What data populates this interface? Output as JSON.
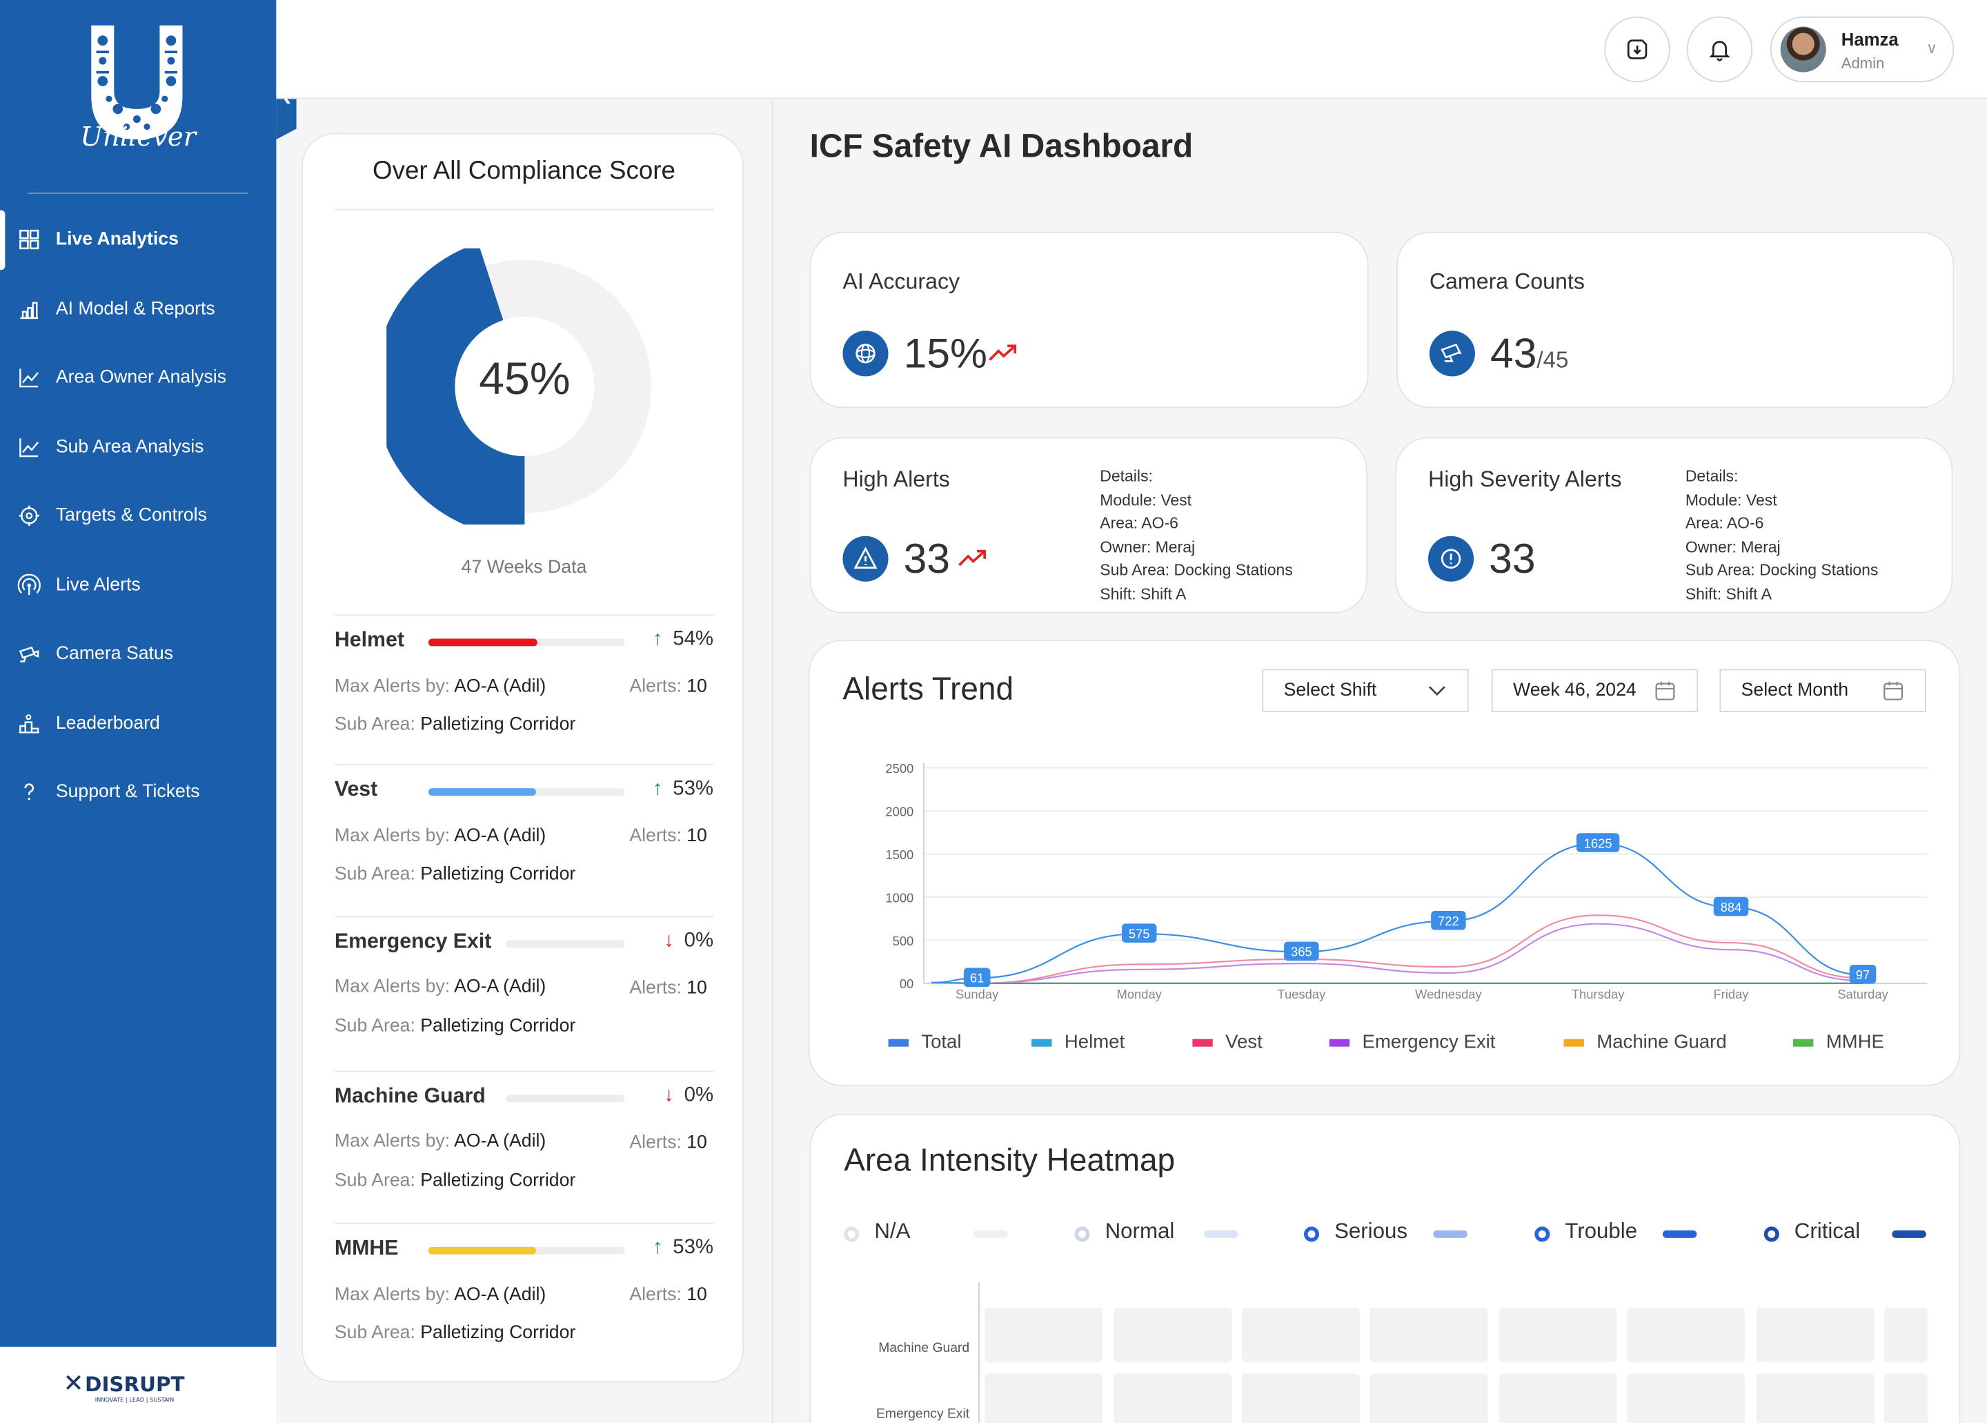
{
  "brand": {
    "name": "Unilever",
    "footer_logo": "THE DISRUPT LABS",
    "footer_tagline": "INNOVATE | LEAD | SUSTAIN"
  },
  "sidebar": {
    "items": [
      {
        "label": "Live Analytics",
        "icon": "grid-icon",
        "active": true
      },
      {
        "label": "AI Model & Reports",
        "icon": "bar-chart-icon"
      },
      {
        "label": "Area Owner Analysis",
        "icon": "line-chart-icon"
      },
      {
        "label": "Sub Area Analysis",
        "icon": "line-chart-icon"
      },
      {
        "label": "Targets & Controls",
        "icon": "target-icon"
      },
      {
        "label": "Live Alerts",
        "icon": "broadcast-icon"
      },
      {
        "label": "Camera Satus",
        "icon": "camera-icon"
      },
      {
        "label": "Leaderboard",
        "icon": "podium-icon"
      },
      {
        "label": "Support & Tickets",
        "icon": "question-icon"
      }
    ]
  },
  "user": {
    "name": "Hamza",
    "role": "Admin"
  },
  "compliance": {
    "title": "Over All Compliance Score",
    "score": "45%",
    "score_value": 45,
    "footnote": "47 Weeks Data",
    "max_alerts_label": "Max Alerts by:",
    "alerts_label": "Alerts:",
    "sub_area_label": "Sub Area:",
    "categories": [
      {
        "name": "Helmet",
        "pct": "54%",
        "fill": 54,
        "trend": "up",
        "color": "#e8141c",
        "owner": "AO-A (Adil)",
        "alerts": "10",
        "sub_area": "Palletizing Corridor"
      },
      {
        "name": "Vest",
        "pct": "53%",
        "fill": 53,
        "trend": "up",
        "color": "#58a6f0",
        "owner": "AO-A (Adil)",
        "alerts": "10",
        "sub_area": "Palletizing Corridor"
      },
      {
        "name": "Emergency Exit",
        "pct": "0%",
        "fill": 0,
        "trend": "down",
        "color": "#58a6f0",
        "owner": "AO-A (Adil)",
        "alerts": "10",
        "sub_area": "Palletizing Corridor"
      },
      {
        "name": "Machine Guard",
        "pct": "0%",
        "fill": 0,
        "trend": "down",
        "color": "#58a6f0",
        "owner": "AO-A (Adil)",
        "alerts": "10",
        "sub_area": "Palletizing Corridor"
      },
      {
        "name": "MMHE",
        "pct": "53%",
        "fill": 53,
        "trend": "up",
        "color": "#f2c92d",
        "owner": "AO-A (Adil)",
        "alerts": "10",
        "sub_area": "Palletizing Corridor"
      }
    ]
  },
  "dashboard": {
    "title": "ICF Safety AI Dashboard"
  },
  "kpis": {
    "ai_accuracy": {
      "title": "AI Accuracy",
      "value": "15%"
    },
    "camera_counts": {
      "title": "Camera Counts",
      "value": "43",
      "total": "/45"
    },
    "high_alerts": {
      "title": "High Alerts",
      "value": "33",
      "details": [
        "Details:",
        "Module: Vest",
        "Area: AO-6",
        "Owner: Meraj",
        "Sub Area: Docking Stations",
        "Shift: Shift A"
      ]
    },
    "high_severity": {
      "title": "High Severity Alerts",
      "value": "33",
      "details": [
        "Details:",
        "Module: Vest",
        "Area: AO-6",
        "Owner: Meraj",
        "Sub Area: Docking Stations",
        "Shift: Shift A"
      ]
    }
  },
  "alerts_trend": {
    "title": "Alerts Trend",
    "filters": {
      "shift": "Select Shift",
      "week": "Week 46, 2024",
      "month": "Select Month"
    }
  },
  "chart_data": {
    "type": "line",
    "categories": [
      "Sunday",
      "Monday",
      "Tuesday",
      "Wednesday",
      "Thursday",
      "Friday",
      "Saturday"
    ],
    "ylim": [
      0,
      2500
    ],
    "yticks": [
      "00",
      "500",
      "1000",
      "1500",
      "2000",
      "2500"
    ],
    "grid": true,
    "legend_position": "bottom",
    "series": [
      {
        "name": "Total",
        "color": "#3b8ee8",
        "values": [
          61,
          575,
          365,
          722,
          1625,
          884,
          97
        ],
        "labeled": true
      },
      {
        "name": "Helmet",
        "color": "#2fa6d8",
        "values": [
          0,
          0,
          0,
          0,
          0,
          0,
          0
        ]
      },
      {
        "name": "Vest",
        "color": "#f08aa8",
        "values": [
          0,
          220,
          280,
          190,
          790,
          470,
          60
        ]
      },
      {
        "name": "Emergency Exit",
        "color": "#c48ae8",
        "values": [
          0,
          160,
          230,
          120,
          690,
          390,
          30
        ]
      },
      {
        "name": "Machine Guard",
        "color": "#f5a623",
        "values": [
          0,
          0,
          0,
          0,
          0,
          0,
          0
        ]
      },
      {
        "name": "MMHE",
        "color": "#55b84a",
        "values": [
          0,
          0,
          0,
          0,
          0,
          0,
          0
        ]
      }
    ],
    "legend_colors": [
      "#3b7de0",
      "#2fa6d8",
      "#e8366b",
      "#a23ee8",
      "#f5a623",
      "#55b84a"
    ]
  },
  "heatmap": {
    "title": "Area Intensity Heatmap",
    "levels": [
      {
        "label": "N/A",
        "dot": "#e3e3e3",
        "bar": "#efefef"
      },
      {
        "label": "Normal",
        "dot": "#cdd6e6",
        "bar": "#dbe4f5"
      },
      {
        "label": "Serious",
        "dot": "#2a63d6",
        "bar": "#9bb5ee"
      },
      {
        "label": "Trouble",
        "dot": "#2a63d6",
        "bar": "#2a63d6"
      },
      {
        "label": "Critical",
        "dot": "#1d4fa8",
        "bar": "#1d4fa8"
      }
    ],
    "rows": [
      "Machine Guard",
      "Emergency Exit"
    ]
  }
}
